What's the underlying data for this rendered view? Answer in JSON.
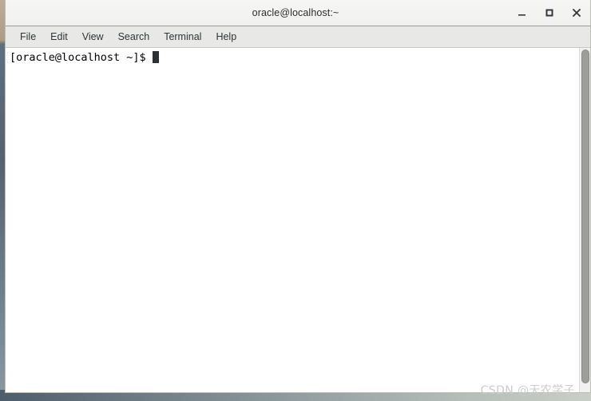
{
  "window": {
    "title": "oracle@localhost:~",
    "controls": [
      {
        "name": "minimize-button",
        "label": "–",
        "icon": "minimize-icon"
      },
      {
        "name": "maximize-button",
        "label": "□",
        "icon": "maximize-icon"
      },
      {
        "name": "close-button",
        "label": "✕",
        "icon": "close-icon"
      }
    ]
  },
  "menubar": {
    "items": [
      {
        "label": "File"
      },
      {
        "label": "Edit"
      },
      {
        "label": "View"
      },
      {
        "label": "Search"
      },
      {
        "label": "Terminal"
      },
      {
        "label": "Help"
      }
    ]
  },
  "terminal": {
    "lines": [
      "[oracle@localhost ~]$ "
    ],
    "prompt": "[oracle@localhost ~]$ ",
    "cursor_visible": true,
    "foreground_color": "#000000",
    "background_color": "#ffffff"
  },
  "scrollbar": {
    "orientation": "vertical",
    "thumb_position": "top"
  },
  "watermark": {
    "text": "CSDN @天农学子"
  },
  "colors": {
    "titlebar": "#f2f2f0",
    "menubar": "#e8e8e6",
    "terminal_bg": "#ffffff",
    "scrollbar_thumb": "#9d9d9a",
    "desktop_strip": "#5f6f7c"
  }
}
